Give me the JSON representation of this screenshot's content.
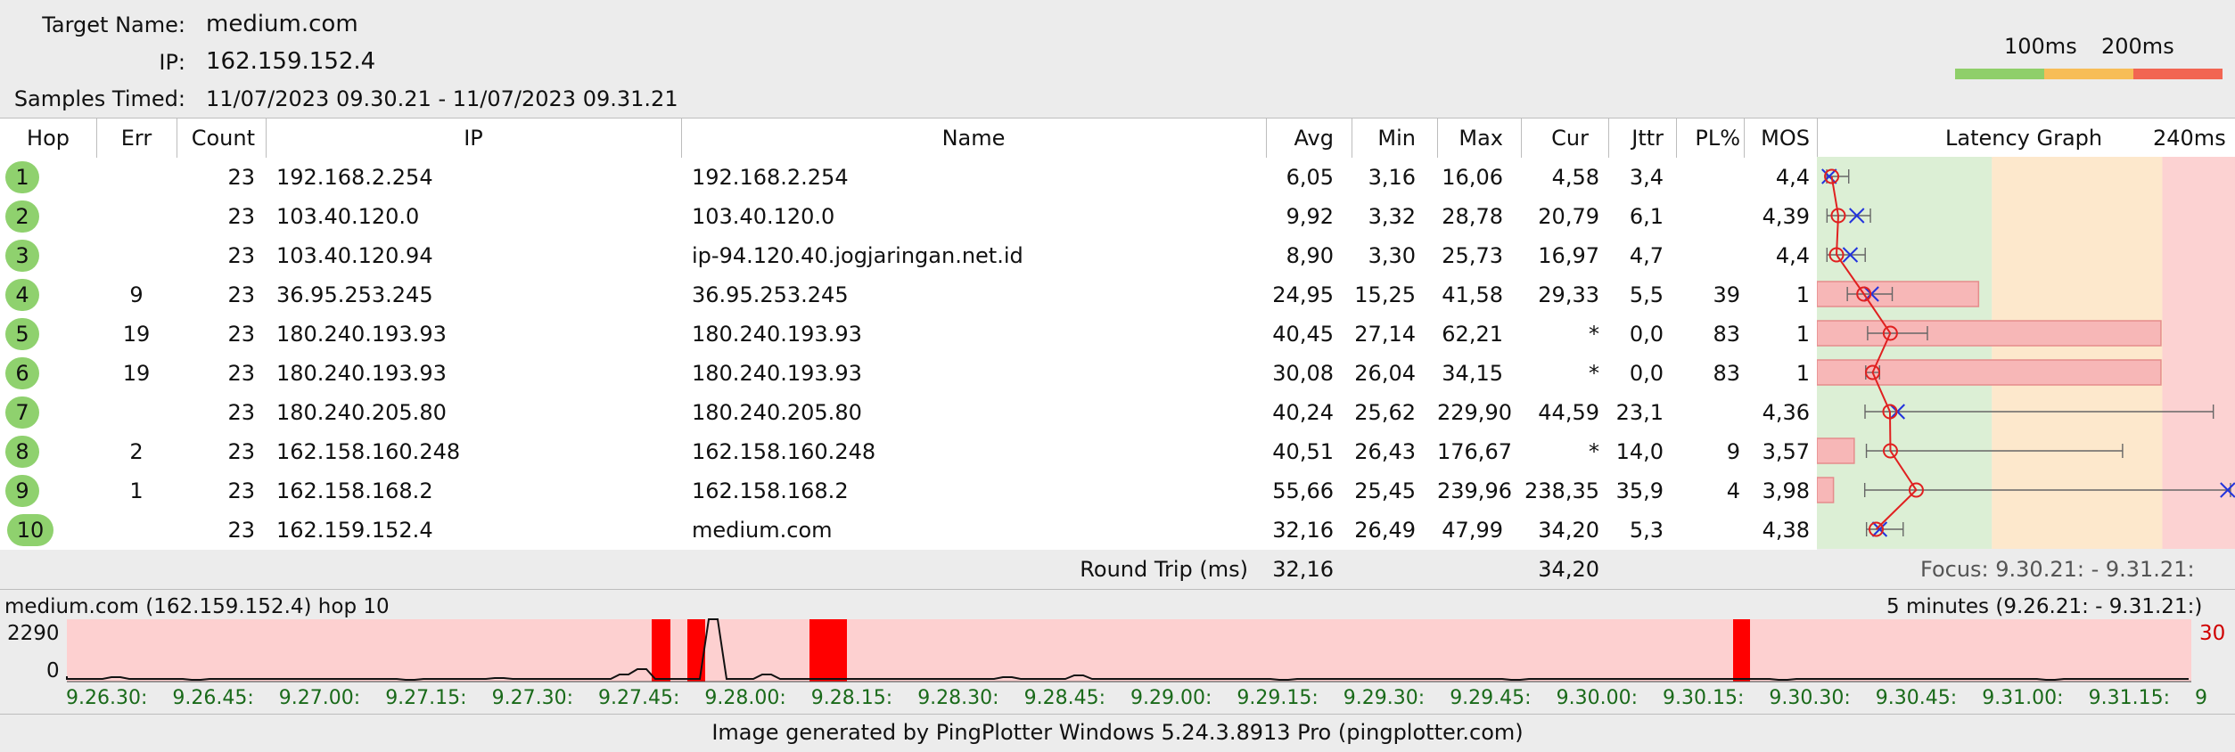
{
  "header": {
    "target_label": "Target Name:",
    "target_value": "medium.com",
    "ip_label": "IP:",
    "ip_value": "162.159.152.4",
    "samples_label": "Samples Timed:",
    "samples_value": "11/07/2023 09.30.21 - 11/07/2023 09.31.21"
  },
  "legend": {
    "label_100": "100ms",
    "label_200": "200ms",
    "colors": [
      "#8fcf6a",
      "#f7bd57",
      "#f26552"
    ]
  },
  "columns": {
    "hop": "Hop",
    "err": "Err",
    "count": "Count",
    "ip": "IP",
    "name": "Name",
    "avg": "Avg",
    "min": "Min",
    "max": "Max",
    "cur": "Cur",
    "jttr": "Jttr",
    "pl": "PL%",
    "mos": "MOS",
    "graph": "Latency Graph",
    "graph_max": "240ms"
  },
  "rows": [
    {
      "hop": "1",
      "err": "",
      "count": "23",
      "ip": "192.168.2.254",
      "name": "192.168.2.254",
      "avg": "6,05",
      "min": "3,16",
      "max": "16,06",
      "cur": "4,58",
      "jttr": "3,4",
      "pl": "",
      "mos": "4,4"
    },
    {
      "hop": "2",
      "err": "",
      "count": "23",
      "ip": "103.40.120.0",
      "name": "103.40.120.0",
      "avg": "9,92",
      "min": "3,32",
      "max": "28,78",
      "cur": "20,79",
      "jttr": "6,1",
      "pl": "",
      "mos": "4,39"
    },
    {
      "hop": "3",
      "err": "",
      "count": "23",
      "ip": "103.40.120.94",
      "name": "ip-94.120.40.jogjaringan.net.id",
      "avg": "8,90",
      "min": "3,30",
      "max": "25,73",
      "cur": "16,97",
      "jttr": "4,7",
      "pl": "",
      "mos": "4,4"
    },
    {
      "hop": "4",
      "err": "9",
      "count": "23",
      "ip": "36.95.253.245",
      "name": "36.95.253.245",
      "avg": "24,95",
      "min": "15,25",
      "max": "41,58",
      "cur": "29,33",
      "jttr": "5,5",
      "pl": "39",
      "mos": "1"
    },
    {
      "hop": "5",
      "err": "19",
      "count": "23",
      "ip": "180.240.193.93",
      "name": "180.240.193.93",
      "avg": "40,45",
      "min": "27,14",
      "max": "62,21",
      "cur": "*",
      "jttr": "0,0",
      "pl": "83",
      "mos": "1"
    },
    {
      "hop": "6",
      "err": "19",
      "count": "23",
      "ip": "180.240.193.93",
      "name": "180.240.193.93",
      "avg": "30,08",
      "min": "26,04",
      "max": "34,15",
      "cur": "*",
      "jttr": "0,0",
      "pl": "83",
      "mos": "1"
    },
    {
      "hop": "7",
      "err": "",
      "count": "23",
      "ip": "180.240.205.80",
      "name": "180.240.205.80",
      "avg": "40,24",
      "min": "25,62",
      "max": "229,90",
      "cur": "44,59",
      "jttr": "23,1",
      "pl": "",
      "mos": "4,36"
    },
    {
      "hop": "8",
      "err": "2",
      "count": "23",
      "ip": "162.158.160.248",
      "name": "162.158.160.248",
      "avg": "40,51",
      "min": "26,43",
      "max": "176,67",
      "cur": "*",
      "jttr": "14,0",
      "pl": "9",
      "mos": "3,57"
    },
    {
      "hop": "9",
      "err": "1",
      "count": "23",
      "ip": "162.158.168.2",
      "name": "162.158.168.2",
      "avg": "55,66",
      "min": "25,45",
      "max": "239,96",
      "cur": "238,35",
      "jttr": "35,9",
      "pl": "4",
      "mos": "3,98"
    },
    {
      "hop": "10",
      "err": "",
      "count": "23",
      "ip": "162.159.152.4",
      "name": "medium.com",
      "avg": "32,16",
      "min": "26,49",
      "max": "47,99",
      "cur": "34,20",
      "jttr": "5,3",
      "pl": "",
      "mos": "4,38"
    }
  ],
  "summary": {
    "label": "Round Trip (ms)",
    "avg": "32,16",
    "cur": "34,20",
    "focus": "Focus: 9.30.21: - 9.31.21:"
  },
  "timeline": {
    "title": "medium.com (162.159.152.4) hop 10",
    "range": "5 minutes (9.26.21: - 9.31.21:)",
    "y_top": "2290",
    "y_bottom": "0",
    "loss_scale": "30",
    "ticks": [
      "9.26.30:",
      "9.26.45:",
      "9.27.00:",
      "9.27.15:",
      "9.27.30:",
      "9.27.45:",
      "9.28.00:",
      "9.28.15:",
      "9.28.30:",
      "9.28.45:",
      "9.29.00:",
      "9.29.15:",
      "9.29.30:",
      "9.29.45:",
      "9.30.00:",
      "9.30.15:",
      "9.30.30:",
      "9.30.45:",
      "9.31.00:",
      "9.31.15:",
      "9"
    ]
  },
  "footer": "Image generated by PingPlotter Windows 5.24.3.8913 Pro (pingplotter.com)"
}
